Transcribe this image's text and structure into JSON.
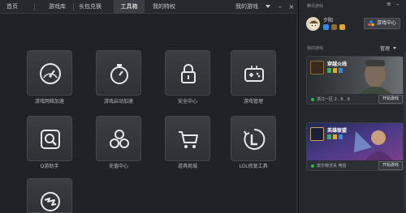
{
  "nav": {
    "tabs": [
      "首页",
      "游戏库",
      "长包兑换",
      "工具箱",
      "我的特权"
    ],
    "active_tab": "工具箱",
    "my_games": "我的游戏",
    "minimize": "–",
    "close": "×"
  },
  "tools": [
    {
      "label": "游戏网络加速",
      "icon": "speedometer-icon"
    },
    {
      "label": "游戏启动加速",
      "icon": "stopwatch-icon"
    },
    {
      "label": "安全中心",
      "icon": "lock-icon"
    },
    {
      "label": "游戏管理",
      "icon": "gamepad-icon"
    },
    {
      "label": "Q游助手",
      "icon": "magnifier-icon"
    },
    {
      "label": "充值中心",
      "icon": "coins-icon"
    },
    {
      "label": "道具商城",
      "icon": "shopping-cart-icon"
    },
    {
      "label": "LOL修复工具",
      "icon": "lol-repair-icon"
    },
    {
      "label": "",
      "icon": "crossfire-icon"
    }
  ],
  "panel": {
    "title": "腾讯游戏",
    "ctrl_menu": "≡",
    "ctrl_min": "–",
    "username": "夕阳",
    "center_button": "游戏中心",
    "my_games_label": "我的游戏",
    "manage_label": "管理",
    "games": [
      {
        "name": "穿越火线",
        "server": "浙江一区  2 . 6 . 9",
        "start": "开始游戏"
      },
      {
        "name": "英雄联盟",
        "server": "皮尔特沃夫  电信",
        "start": "开始游戏"
      }
    ]
  },
  "colors": {
    "accent_blue": "#2d8cf0",
    "online_green": "#2db84d",
    "badge_gold": "#e0a82e"
  }
}
